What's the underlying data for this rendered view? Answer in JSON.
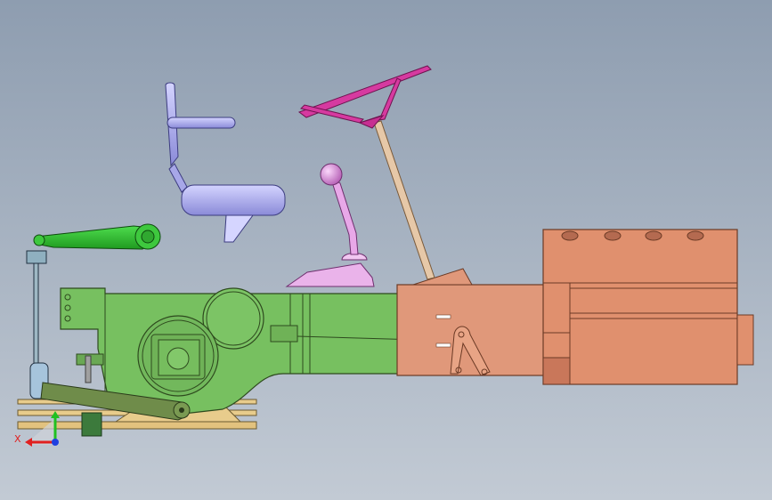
{
  "viewport": {
    "background_top": "#8e9db0",
    "background_bottom": "#c2cad4"
  },
  "model": {
    "parts": [
      {
        "name": "steering-wheel",
        "color": "#d63aa0"
      },
      {
        "name": "steering-column",
        "color": "#e6c8a8"
      },
      {
        "name": "gear-shift-lever",
        "color": "#e8a8e8"
      },
      {
        "name": "seat",
        "color": "#b8b8f0"
      },
      {
        "name": "lift-arm",
        "color": "#2db82d"
      },
      {
        "name": "rear-axle-housing",
        "color": "#77c060"
      },
      {
        "name": "transmission-housing",
        "color": "#e0987a"
      },
      {
        "name": "engine-block",
        "color": "#e0906e"
      },
      {
        "name": "lower-link",
        "color": "#6f8c4a"
      },
      {
        "name": "drawbar",
        "color": "#e8cc8c"
      }
    ]
  },
  "triad": {
    "x_label": "X",
    "x_color": "#e02020",
    "y_color": "#20c020",
    "z_color": "#2040e0"
  }
}
